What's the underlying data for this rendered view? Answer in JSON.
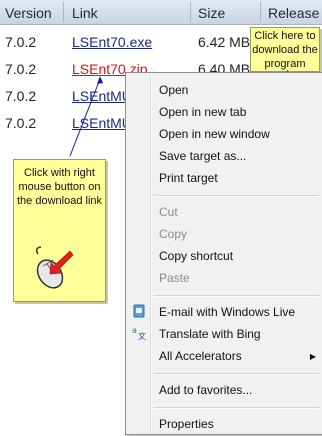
{
  "table": {
    "headers": [
      "Version",
      "Link",
      "Size",
      "Release"
    ],
    "rows": [
      {
        "version": "7.0.2",
        "link": "LSEnt70.exe",
        "size": "6.42 MB"
      },
      {
        "version": "7.0.2",
        "link": "LSEnt70.zip",
        "size": "6.40 MB"
      },
      {
        "version": "7.0.2",
        "link": "LSEntMU",
        "size": ""
      },
      {
        "version": "7.0.2",
        "link": "LSEntMU",
        "size": ""
      }
    ]
  },
  "callouts": {
    "download": "Click here to download the program",
    "right_click": "Click with right mouse button on the download link"
  },
  "menu": {
    "open": "Open",
    "open_tab": "Open in new tab",
    "open_window": "Open in new window",
    "save_target": "Save target as...",
    "print_target": "Print target",
    "cut": "Cut",
    "copy": "Copy",
    "copy_shortcut": "Copy shortcut",
    "paste": "Paste",
    "email": "E-mail with Windows Live",
    "translate": "Translate with Bing",
    "accelerators": "All Accelerators",
    "favorites": "Add to favorites...",
    "properties": "Properties"
  },
  "colors": {
    "header_bg": "#d4dbe6",
    "link": "#1b2b80",
    "link_active": "#e01010",
    "callout_bg": "#ffff99",
    "menu_bg": "#f1f1f1"
  }
}
